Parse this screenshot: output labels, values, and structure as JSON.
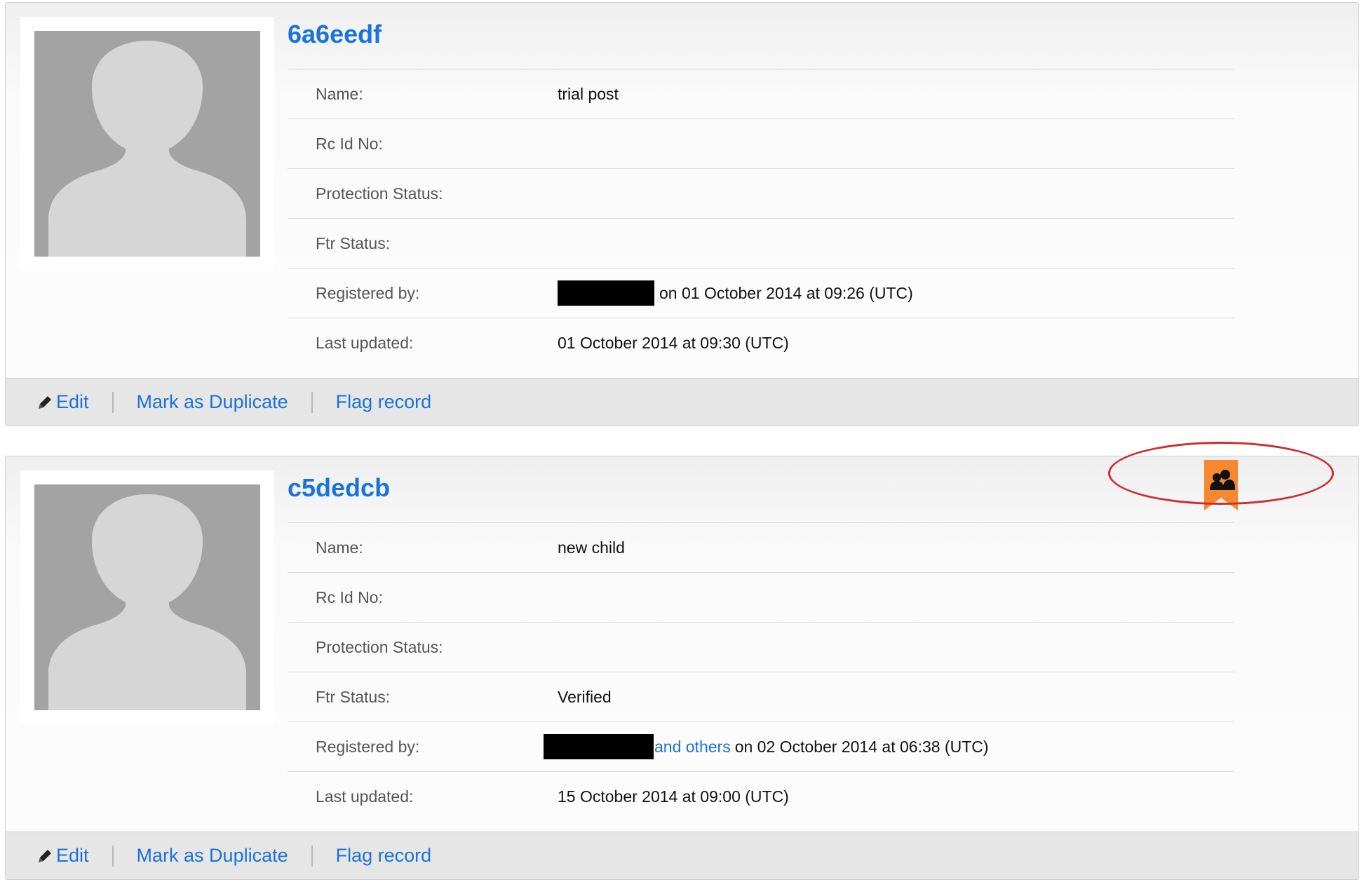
{
  "records": [
    {
      "id": "6a6eedf",
      "fields": {
        "name_label": "Name:",
        "name_value": "trial post",
        "rc_label": "Rc Id No:",
        "rc_value": "",
        "protection_label": "Protection Status:",
        "protection_value": "",
        "ftr_label": "Ftr Status:",
        "ftr_value": "",
        "registered_label": "Registered by:",
        "registered_text": "on 01 October 2014 at 09:26 (UTC)",
        "updated_label": "Last updated:",
        "updated_value": "01 October 2014 at 09:30 (UTC)"
      },
      "actions": {
        "edit": "Edit",
        "duplicate": "Mark as Duplicate",
        "flag": "Flag record"
      }
    },
    {
      "id": "c5dedcb",
      "fields": {
        "name_label": "Name:",
        "name_value": "new child",
        "rc_label": "Rc Id No:",
        "rc_value": "",
        "protection_label": "Protection Status:",
        "protection_value": "",
        "ftr_label": "Ftr Status:",
        "ftr_value": "Verified",
        "registered_label": "Registered by:",
        "registered_link": "and others",
        "registered_text": "on 02 October 2014 at 06:38 (UTC)",
        "updated_label": "Last updated:",
        "updated_value": "15 October 2014 at 09:00 (UTC)"
      },
      "actions": {
        "edit": "Edit",
        "duplicate": "Mark as Duplicate",
        "flag": "Flag record"
      },
      "badge": {
        "icon": "family-reunification-icon",
        "color": "#f7882f"
      }
    }
  ],
  "colors": {
    "link": "#1a73d9",
    "annotation": "#cc2e2e",
    "badge": "#f7882f"
  }
}
